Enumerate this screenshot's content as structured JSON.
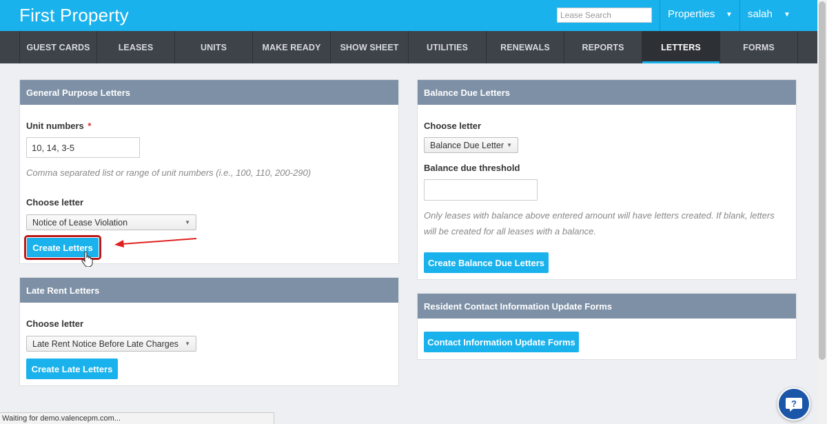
{
  "header": {
    "brand": "First Property",
    "search_placeholder": "Lease Search",
    "properties_label": "Properties",
    "user_label": "salah"
  },
  "nav": {
    "items": [
      "GUEST CARDS",
      "LEASES",
      "UNITS",
      "MAKE READY",
      "SHOW SHEET",
      "UTILITIES",
      "RENEWALS",
      "REPORTS",
      "LETTERS",
      "FORMS"
    ],
    "active": "LETTERS"
  },
  "general": {
    "title": "General Purpose Letters",
    "unit_label": "Unit numbers",
    "required_mark": "*",
    "unit_value": "10, 14, 3-5",
    "unit_hint": "Comma separated list or range of unit numbers (i.e., 100, 110, 200-290)",
    "choose_label": "Choose letter",
    "selected_letter": "Notice of Lease Violation",
    "button": "Create Letters"
  },
  "late": {
    "title": "Late Rent Letters",
    "choose_label": "Choose letter",
    "selected_letter": "Late Rent Notice Before Late Charges",
    "button": "Create Late Letters"
  },
  "balance": {
    "title": "Balance Due Letters",
    "choose_label": "Choose letter",
    "selected_letter": "Balance Due Letter",
    "threshold_label": "Balance due threshold",
    "threshold_value": "",
    "hint_line1": "Only leases with balance above entered amount will have letters created. If blank, letters",
    "hint_line2": "will be created for all leases with a balance.",
    "button": "Create Balance Due Letters"
  },
  "contact": {
    "title": "Resident Contact Information Update Forms",
    "button": "Contact Information Update Forms"
  },
  "statusbar": {
    "text": "Waiting for demo.valencepm.com..."
  },
  "colors": {
    "accent": "#1ab2ec",
    "nav_bg": "#3e4249",
    "panel_header": "#7d90a6",
    "highlight": "#c01818",
    "help_bg": "#1c56a8"
  }
}
